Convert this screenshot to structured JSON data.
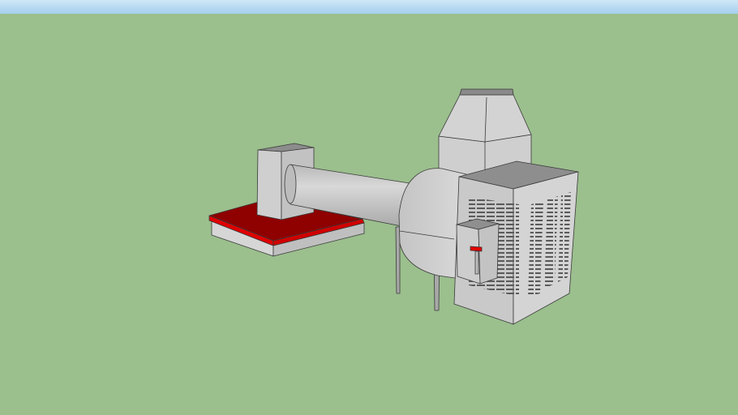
{
  "colors": {
    "sky_top": "#c9e3f5",
    "sky_bottom": "#a7d0ee",
    "ground": "#9bbf8d",
    "metal_light": "#d2d2d2",
    "metal_mid": "#bdbdbd",
    "metal_dark": "#9e9e9e",
    "accent_red": "#e00000",
    "accent_red_dark": "#a00000"
  }
}
